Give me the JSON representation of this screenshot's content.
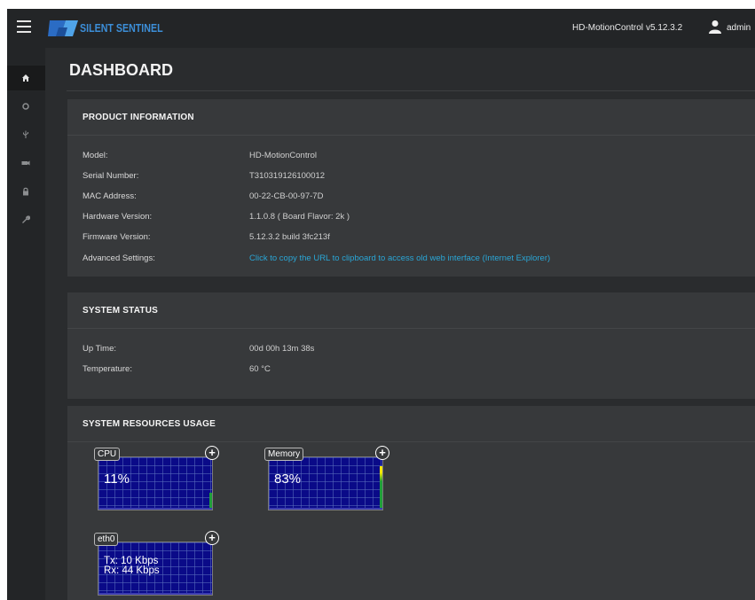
{
  "topbar": {
    "logo_text": "SILENT SENTINEL",
    "product": "HD-MotionControl",
    "version": "v5.12.3.2",
    "user": "admin"
  },
  "sidebar": {
    "items": [
      {
        "icon": "home-icon",
        "active": true
      },
      {
        "icon": "circle-icon",
        "active": false
      },
      {
        "icon": "usb-icon",
        "active": false
      },
      {
        "icon": "camera-icon",
        "active": false
      },
      {
        "icon": "lock-icon",
        "active": false
      },
      {
        "icon": "wrench-icon",
        "active": false
      }
    ]
  },
  "page": {
    "title": "DASHBOARD"
  },
  "product_info": {
    "title": "PRODUCT INFORMATION",
    "rows": [
      {
        "label": "Model:",
        "value": "HD-MotionControl"
      },
      {
        "label": "Serial Number:",
        "value": "T310319126100012"
      },
      {
        "label": "MAC Address:",
        "value": "00-22-CB-00-97-7D"
      },
      {
        "label": "Hardware Version:",
        "value": "1.1.0.8 ( Board Flavor: 2k )"
      },
      {
        "label": "Firmware Version:",
        "value": "5.12.3.2 build 3fc213f"
      },
      {
        "label": "Advanced Settings:",
        "value": "Click to copy the URL to clipboard to access old web interface (Internet Explorer)"
      }
    ]
  },
  "system_status": {
    "title": "SYSTEM STATUS",
    "rows": [
      {
        "label": "Up Time:",
        "value": "00d 00h 13m 38s"
      },
      {
        "label": "Temperature:",
        "value": "60 °C"
      }
    ]
  },
  "resources": {
    "title": "SYSTEM RESOURCES USAGE",
    "cpu": {
      "label": "CPU",
      "value": "11%",
      "level": 0.11
    },
    "memory": {
      "label": "Memory",
      "value": "83%",
      "level": 0.83
    },
    "eth0": {
      "label": "eth0",
      "tx": "Tx: 10 Kbps",
      "rx": "Rx: 44 Kbps"
    },
    "plus_label": "+"
  },
  "colors": {
    "accent": "#2aa6d6",
    "graph_bg": "#0a0a88",
    "cpu_bar": "#1f9f3a",
    "mem_bar_low": "#1f9f3a",
    "mem_bar_high": "#f5e600"
  }
}
